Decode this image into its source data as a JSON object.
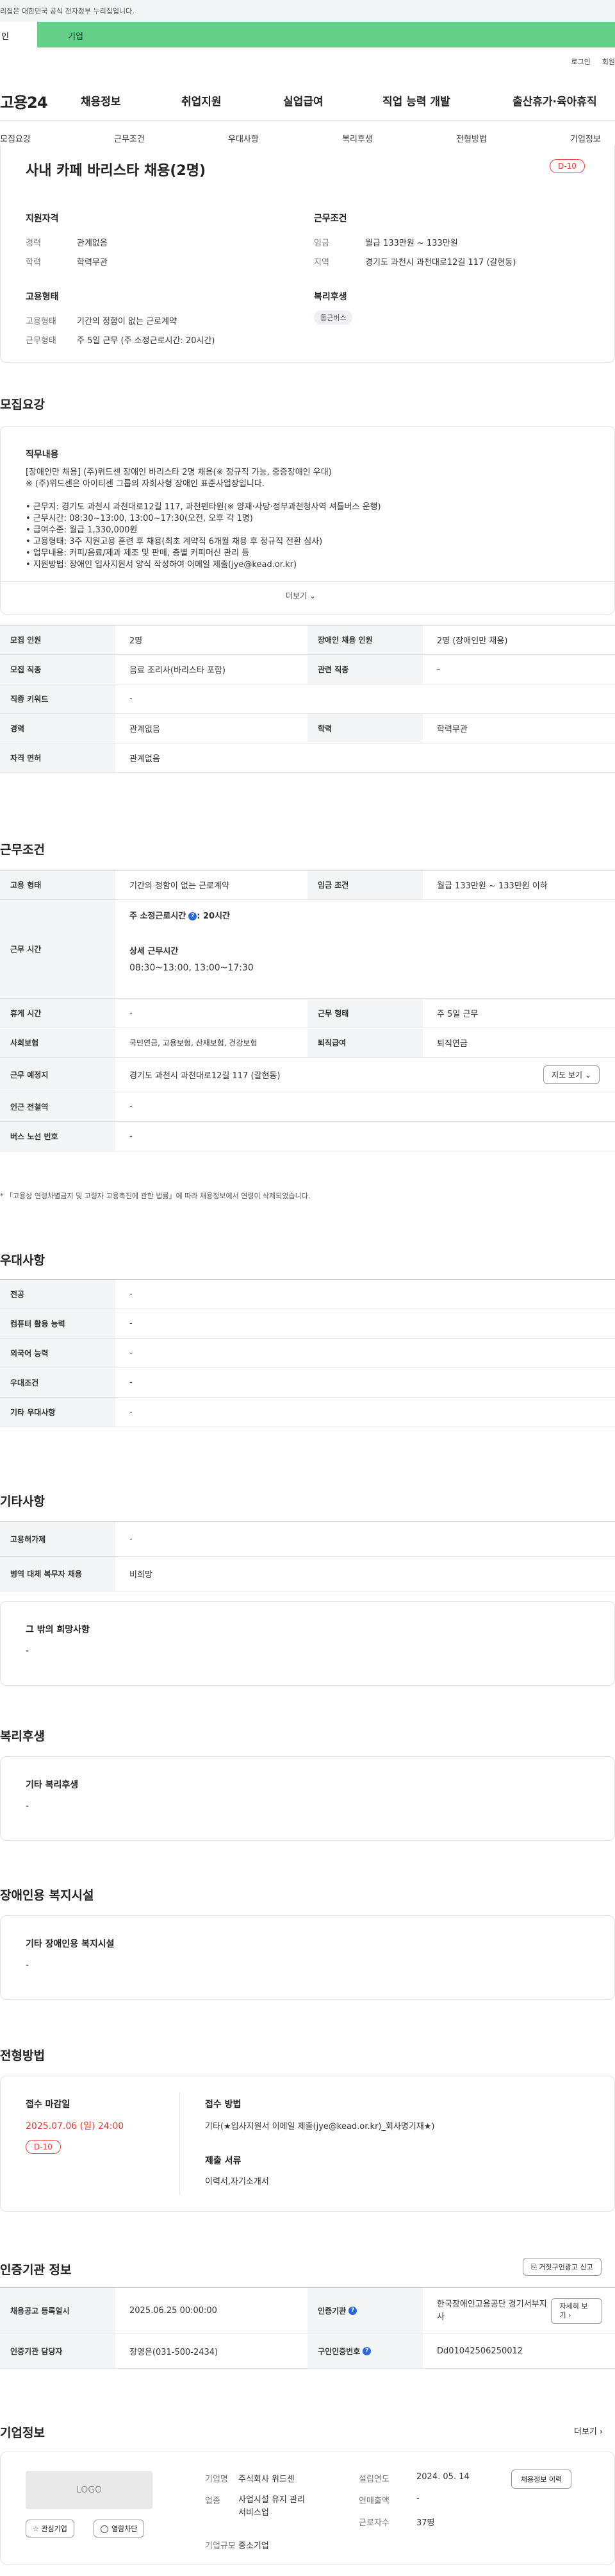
{
  "gov_notice": "리집은 대한민국 공식 전자정부 누리집입니다.",
  "topbar": {
    "left": "인",
    "right": "기업"
  },
  "util": [
    "로그인",
    "회원"
  ],
  "gnb": {
    "logo": "고용24",
    "items": [
      "채용정보",
      "취업지원",
      "실업급여",
      "직업 능력 개발",
      "출산휴가·육아휴직"
    ]
  },
  "tabs": [
    "모집요강",
    "근무조건",
    "우대사항",
    "복리후생",
    "전형방법",
    "기업정보"
  ],
  "summary": {
    "title": "사내 카페 바리스타 채용(2명)",
    "dday": "D-10",
    "qual": {
      "heading": "지원자격",
      "rows": [
        {
          "label": "경력",
          "value": "관계없음"
        },
        {
          "label": "학력",
          "value": "학력무관"
        }
      ]
    },
    "cond": {
      "heading": "근무조건",
      "rows": [
        {
          "label": "임금",
          "value": "월급 133만원 ~ 133만원"
        },
        {
          "label": "지역",
          "value": "경기도 과천시 과천대로12길 117 (갈현동)"
        }
      ]
    },
    "employ": {
      "heading": "고용형태",
      "rows": [
        {
          "label": "고용형태",
          "value": "기간의 정함이 없는 근로계약"
        },
        {
          "label": "근무형태",
          "value": "주 5일 근무 (주 소정근로시간: 20시간)"
        }
      ]
    },
    "welfare": {
      "heading": "복리후생",
      "badge": "통근버스"
    }
  },
  "recruit": {
    "title": "모집요강",
    "duty_heading": "직무내용",
    "duty_lines": [
      "[장애인만 채용] (주)위드센 장애인 바리스타 2명 채용(※ 정규직 가능, 중증장애인 우대)",
      "※ (주)위드센은 아이티센 그룹의 자회사형 장애인 표준사업장입니다.",
      "",
      "• 근무지: 경기도 과천시 과천대로12길 117, 과천펜타원(※ 양재·사당·정부과천청사역 셔틀버스 운행)",
      "• 근무시간: 08:30~13:00, 13:00~17:30(오전, 오후 각 1명)",
      "• 급여수준: 월급 1,330,000원",
      "• 고용형태: 3주 지원고용 훈련 후 채용(최초 계약직 6개월 채용 후 정규직 전환 심사)",
      "• 업무내용: 커피/음료/제과 제조 및 판매, 층별 커피머신 관리 등",
      "• 지원방법: 장애인 입사지원서 양식 작성하여 이메일 제출(jye@kead.or.kr)"
    ],
    "more": "더보기",
    "table": [
      {
        "l1": "모집 인원",
        "v1": "2명",
        "l2": "장애인 채용 인원",
        "v2": "2명 (장애인만 채용)"
      },
      {
        "l1": "모집 직종",
        "v1": "음료 조리사(바리스타 포함)",
        "l2": "관련 직종",
        "v2": "-"
      },
      {
        "l1": "직종 키워드",
        "v1": "-"
      },
      {
        "l1": "경력",
        "v1": "관계없음",
        "l2": "학력",
        "v2": "학력무관"
      },
      {
        "l1": "자격 면허",
        "v1": "관계없음"
      }
    ]
  },
  "work": {
    "title": "근무조건",
    "employ_label": "고용 형태",
    "employ_value": "기간의 정함이 없는 근로계약",
    "wage_label": "임금 조건",
    "wage_value": "월급 133만원 ~ 133만원 이하",
    "time_label": "근무 시간",
    "time_std_label": "주 소정근로시간",
    "time_std_value": ": 20시간",
    "time_detail_label": "상세 근무시간",
    "time_detail_value": "08:30~13:00, 13:00~17:30",
    "rest_label": "휴게 시간",
    "rest_value": "-",
    "form_label": "근무 형태",
    "form_value": "주 5일 근무",
    "ins_label": "사회보험",
    "ins_value": "국민연금, 고용보험, 산재보험, 건강보험",
    "ret_label": "퇴직급여",
    "ret_value": "퇴직연금",
    "place_label": "근무 예정지",
    "place_value": "경기도 과천시 과천대로12길 117 (갈현동)",
    "map_btn": "지도 보기",
    "subway_label": "인근 전철역",
    "subway_value": "-",
    "bus_label": "버스 노선 번호",
    "bus_value": "-",
    "note": "* 「고용상 연령차별금지 및 고령자 고용촉진에 관한 법률」에 따라 채용정보에서 연령이 삭제되었습니다."
  },
  "pref": {
    "title": "우대사항",
    "rows": [
      {
        "label": "전공",
        "value": "-"
      },
      {
        "label": "컴퓨터 활용 능력",
        "value": "-"
      },
      {
        "label": "외국어 능력",
        "value": "-"
      },
      {
        "label": "우대조건",
        "value": "-"
      },
      {
        "label": "기타 우대사항",
        "value": "-"
      }
    ]
  },
  "etc": {
    "title": "기타사항",
    "rows": [
      {
        "label": "고용허가제",
        "value": "-"
      },
      {
        "label": "병역 대체 복무자 채용",
        "value": "비희망"
      }
    ],
    "card_label": "그 밖의 희망사항",
    "card_value": "-"
  },
  "welfare_sec": {
    "title": "복리후생",
    "card_label": "기타 복리후생",
    "card_value": "-"
  },
  "disab_sec": {
    "title": "장애인용 복지시설",
    "card_label": "기타 장애인용 복지시설",
    "card_value": "-"
  },
  "select": {
    "title": "전형방법",
    "deadline_label": "접수 마감일",
    "deadline_value": "2025.07.06 (일) 24:00",
    "dday": "D-10",
    "method_label": "접수 방법",
    "method_value": "기타(★입사지원서 이메일 제출(jye@kead.or.kr)_회사명기재★)",
    "docs_label": "제출 서류",
    "docs_value": "이력서,자기소개서"
  },
  "cert": {
    "title": "인증기관 정보",
    "report_btn": "거짓구인광고 신고",
    "reg_label": "채용공고 등록일시",
    "reg_value": "2025.06.25 00:00:00",
    "org_label": "인증기관",
    "org_value": "한국장애인고용공단 경기서부지사",
    "detail_btn": "자세히 보기",
    "mgr_label": "인증기관 담당자",
    "mgr_value": "장영은(031-500-2434)",
    "num_label": "구인인증번호",
    "num_value": "Dd01042506250012"
  },
  "company": {
    "title": "기업정보",
    "more": "더보기",
    "logo": "LOGO",
    "btn_fav": "관심기업",
    "btn_block": "열람차단",
    "name_label": "기업명",
    "name_value": "주식회사 위드센",
    "ind_label": "업종",
    "ind_value": "사업시설 유지 관리 서비스업",
    "size_label": "기업규모",
    "size_value": "중소기업",
    "est_label": "설립연도",
    "est_value": "2024. 05. 14",
    "sales_label": "연매출액",
    "sales_value": "-",
    "emp_label": "근로자수",
    "emp_value": "37명",
    "jobs_btn": "채용정보 이력"
  }
}
